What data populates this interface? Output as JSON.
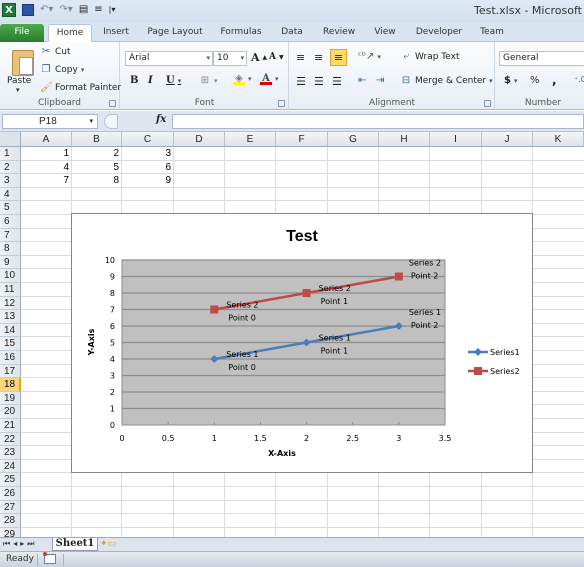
{
  "window": {
    "title": "Test.xlsx - Microsoft"
  },
  "qat": {
    "items": [
      "excel-logo",
      "save",
      "undo",
      "redo",
      "customize-a",
      "customize-b",
      "more"
    ]
  },
  "tabs": [
    {
      "label": "File"
    },
    {
      "label": "Home"
    },
    {
      "label": "Insert"
    },
    {
      "label": "Page Layout"
    },
    {
      "label": "Formulas"
    },
    {
      "label": "Data"
    },
    {
      "label": "Review"
    },
    {
      "label": "View"
    },
    {
      "label": "Developer"
    },
    {
      "label": "Team"
    }
  ],
  "ribbon": {
    "clipboard": {
      "label": "Clipboard",
      "paste": "Paste",
      "cut": "Cut",
      "copy": "Copy",
      "format_painter": "Format Painter"
    },
    "font": {
      "label": "Font",
      "font_name": "Arial",
      "font_size": "10",
      "bold": "B",
      "italic": "I",
      "underline": "U",
      "grow": "A",
      "shrink": "A",
      "font_color_hex": "#e00000",
      "fill_color_hex": "#ffff00"
    },
    "alignment": {
      "label": "Alignment",
      "wrap_text": "Wrap Text",
      "merge_center": "Merge & Center"
    },
    "number": {
      "label": "Number",
      "format": "General",
      "currency": "$",
      "percent": "%",
      "comma": ","
    }
  },
  "formula_bar": {
    "name_box": "P18",
    "fx": "fx",
    "formula": ""
  },
  "sheet": {
    "columns": [
      "A",
      "B",
      "C",
      "D",
      "E",
      "F",
      "G",
      "H",
      "I",
      "J",
      "K"
    ],
    "rows": [
      "1",
      "2",
      "3",
      "4",
      "5",
      "6",
      "7",
      "8",
      "9",
      "10",
      "11",
      "12",
      "13",
      "14",
      "15",
      "16",
      "17",
      "18",
      "19",
      "20",
      "21",
      "22",
      "23",
      "24",
      "25",
      "26",
      "27",
      "28",
      "29"
    ],
    "selected_row": "18",
    "cells": [
      [
        "1",
        "2",
        "3"
      ],
      [
        "4",
        "5",
        "6"
      ],
      [
        "7",
        "8",
        "9"
      ]
    ]
  },
  "chart_data": {
    "type": "line",
    "title": "Test",
    "xlabel": "X-Axis",
    "ylabel": "Y-Axis",
    "xlim": [
      0,
      3.5
    ],
    "ylim": [
      0,
      10
    ],
    "xticks": [
      "0",
      "0.5",
      "1",
      "1.5",
      "2",
      "2.5",
      "3",
      "3.5"
    ],
    "yticks": [
      "0",
      "1",
      "2",
      "3",
      "4",
      "5",
      "6",
      "7",
      "8",
      "9",
      "10"
    ],
    "grid": true,
    "legend_position": "right",
    "plot_bg": "#c0c0c0",
    "series": [
      {
        "name": "Series1",
        "color": "#4a7ebb",
        "marker": "diamond",
        "x": [
          1,
          2,
          3
        ],
        "y": [
          4,
          5,
          6
        ],
        "labels": [
          [
            "Series 1",
            "Point 0"
          ],
          [
            "Series 1",
            "Point 1"
          ],
          [
            "Series 1",
            "Point 2"
          ]
        ]
      },
      {
        "name": "Series2",
        "color": "#be4b48",
        "marker": "square",
        "x": [
          1,
          2,
          3
        ],
        "y": [
          7,
          8,
          9
        ],
        "labels": [
          [
            "Series 2",
            "Point 0"
          ],
          [
            "Series 2",
            "Point 1"
          ],
          [
            "Series 2",
            "Point 2"
          ]
        ]
      }
    ]
  },
  "sheet_tabs": {
    "active": "Sheet1",
    "nav": "◄◄ ◄ ► ►►"
  },
  "status": {
    "ready": "Ready"
  }
}
